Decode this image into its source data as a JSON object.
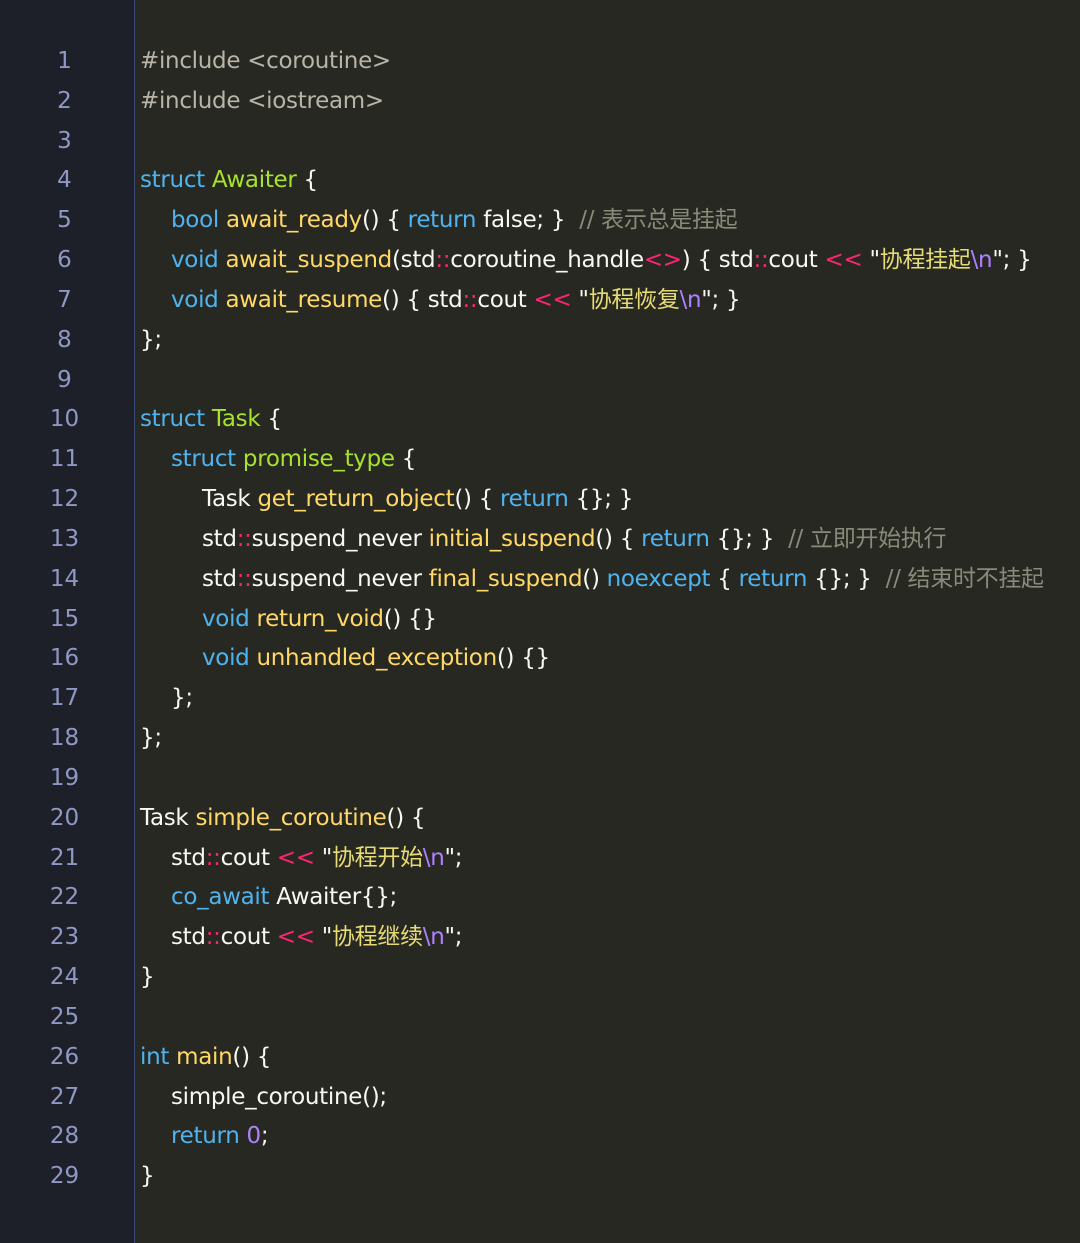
{
  "line_numbers": [
    "1",
    "2",
    "3",
    "4",
    "5",
    "6",
    "7",
    "8",
    "9",
    "10",
    "11",
    "12",
    "13",
    "14",
    "15",
    "16",
    "17",
    "18",
    "19",
    "20",
    "21",
    "22",
    "23",
    "24",
    "25",
    "26",
    "27",
    "28",
    "29"
  ],
  "code": {
    "l1": "#include <coroutine>",
    "l2": "#include <iostream>",
    "l4_kw": "struct",
    "l4_name": "Awaiter",
    "l4_rest": " {",
    "l5_kw": "bool",
    "l5_fn": "await_ready",
    "l5_a": "() { ",
    "l5_ret": "return",
    "l5_b": " false; }  ",
    "l5_cm": "// 表示总是挂起",
    "l6_kw": "void",
    "l6_fn": "await_suspend",
    "l6_a": "(std",
    "l6_op1": "::",
    "l6_b": "coroutine_handle",
    "l6_op2": "<>",
    "l6_c": ") { std",
    "l6_op3": "::",
    "l6_d": "cout ",
    "l6_op4": "<<",
    "l6_e": " \"",
    "l6_str": "协程挂起",
    "l6_esc": "\\n",
    "l6_f": "\"; }",
    "l7_kw": "void",
    "l7_fn": "await_resume",
    "l7_a": "() { std",
    "l7_op1": "::",
    "l7_b": "cout ",
    "l7_op2": "<<",
    "l7_c": " \"",
    "l7_str": "协程恢复",
    "l7_esc": "\\n",
    "l7_d": "\"; }",
    "l8": "};",
    "l10_kw": "struct",
    "l10_name": "Task",
    "l10_rest": " {",
    "l11_kw": "struct",
    "l11_name": "promise_type",
    "l11_rest": " {",
    "l12_a": "Task ",
    "l12_fn": "get_return_object",
    "l12_b": "() { ",
    "l12_ret": "return",
    "l12_c": " {}; }",
    "l13_a": "std",
    "l13_op": "::",
    "l13_b": "suspend_never ",
    "l13_fn": "initial_suspend",
    "l13_c": "() { ",
    "l13_ret": "return",
    "l13_d": " {}; }  ",
    "l13_cm": "// 立即开始执行",
    "l14_a": "std",
    "l14_op": "::",
    "l14_b": "suspend_never ",
    "l14_fn": "final_suspend",
    "l14_c": "() ",
    "l14_kw": "noexcept",
    "l14_d": " { ",
    "l14_ret": "return",
    "l14_e": " {}; }  ",
    "l14_cm": "// 结束时不挂起",
    "l15_kw": "void",
    "l15_fn": "return_void",
    "l15_rest": "() {}",
    "l16_kw": "void",
    "l16_fn": "unhandled_exception",
    "l16_rest": "() {}",
    "l17": "};",
    "l18": "};",
    "l20_a": "Task ",
    "l20_fn": "simple_coroutine",
    "l20_rest": "() {",
    "l21_a": "std",
    "l21_op1": "::",
    "l21_b": "cout ",
    "l21_op2": "<<",
    "l21_c": " \"",
    "l21_str": "协程开始",
    "l21_esc": "\\n",
    "l21_d": "\";",
    "l22_kw": "co_await",
    "l22_rest": " Awaiter{};",
    "l23_a": "std",
    "l23_op1": "::",
    "l23_b": "cout ",
    "l23_op2": "<<",
    "l23_c": " \"",
    "l23_str": "协程继续",
    "l23_esc": "\\n",
    "l23_d": "\";",
    "l24": "}",
    "l26_kw": "int",
    "l26_fn": "main",
    "l26_rest": "() {",
    "l27": "simple_coroutine();",
    "l28_kw": "return",
    "l28_sp": " ",
    "l28_num": "0",
    "l28_rest": ";",
    "l29": "}"
  },
  "colors": {
    "background": "#272822",
    "gutter": "#1e2029",
    "keyword": "#4fb3f0",
    "function": "#ffd866",
    "operator": "#f92672",
    "string": "#e6db74",
    "escape": "#ae81ff",
    "comment": "#8a8a7a"
  }
}
